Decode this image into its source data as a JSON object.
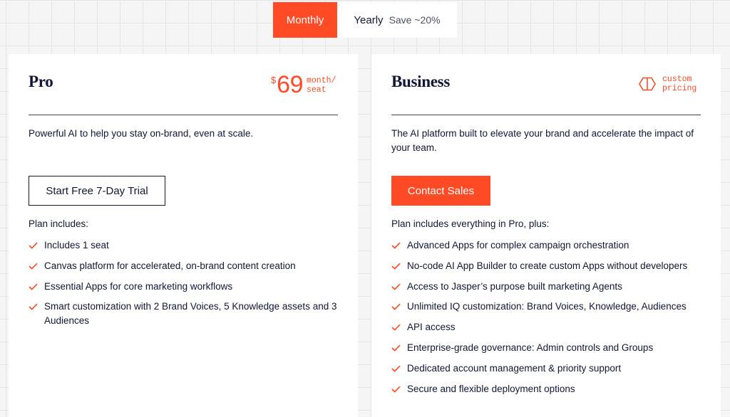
{
  "toggle": {
    "monthly_label": "Monthly",
    "yearly_label": "Yearly",
    "yearly_save": "Save ~20%"
  },
  "pro": {
    "title": "Pro",
    "price_currency": "$",
    "price_amount": "69",
    "price_unit_line1": "month/",
    "price_unit_line2": "seat",
    "description": "Powerful AI to help you stay on-brand, even at scale.",
    "cta_label": "Start Free 7-Day Trial",
    "includes_title": "Plan includes:",
    "features": [
      "Includes 1 seat",
      "Canvas platform for accelerated, on-brand content creation",
      "Essential Apps for core marketing workflows",
      "Smart customization with 2 Brand Voices, 5 Knowledge assets and 3 Audiences"
    ]
  },
  "business": {
    "title": "Business",
    "pricing_line1": "custom",
    "pricing_line2": "pricing",
    "description": "The AI platform built to elevate your brand and accelerate the impact of your team.",
    "cta_label": "Contact Sales",
    "includes_title": "Plan includes everything in Pro, plus:",
    "features": [
      "Advanced Apps for complex campaign orchestration",
      "No-code AI App Builder to create custom Apps without developers",
      "Access to Jasper’s purpose built marketing Agents",
      "Unlimited IQ customization: Brand Voices, Knowledge, Audiences",
      "API access",
      "Enterprise-grade governance: Admin controls and Groups",
      "Dedicated account management & priority support",
      "Secure and flexible deployment options"
    ]
  },
  "colors": {
    "accent": "#fe4b25",
    "text": "#111637",
    "divider": "#4a3f36"
  },
  "icons": {
    "feature_bullet": "check-icon",
    "custom_pricing": "hexagon-box-icon"
  }
}
